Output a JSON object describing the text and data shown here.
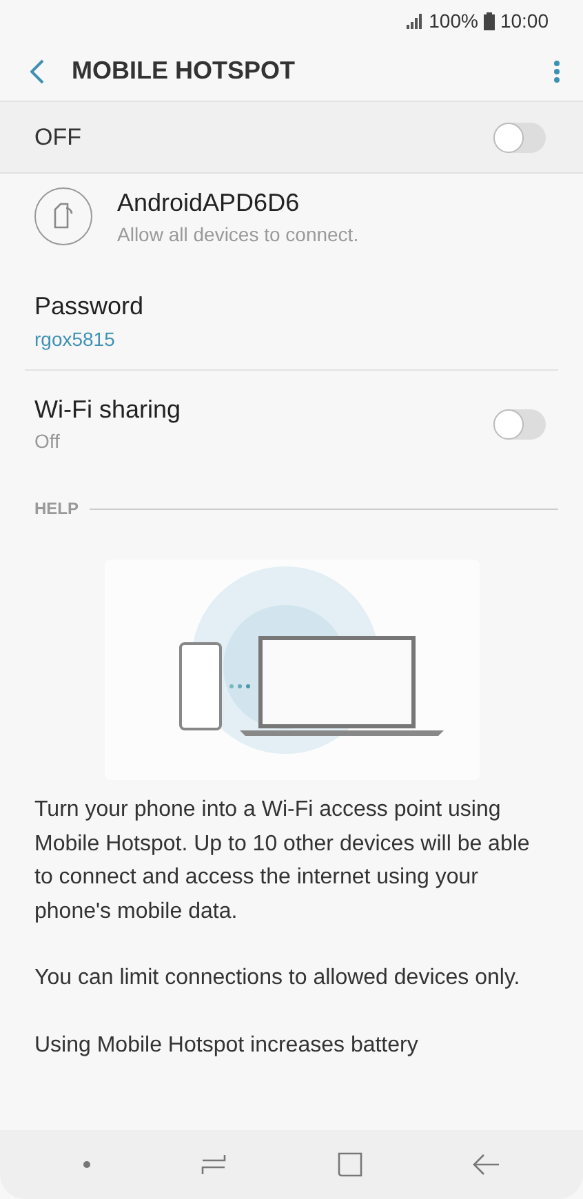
{
  "status_bar": {
    "battery": "100%",
    "time": "10:00"
  },
  "header": {
    "title": "MOBILE HOTSPOT"
  },
  "master_switch": {
    "label": "OFF",
    "on": false
  },
  "network": {
    "name": "AndroidAPD6D6",
    "subtitle": "Allow all devices to connect."
  },
  "password": {
    "label": "Password",
    "value": "rgox5815"
  },
  "wifi_sharing": {
    "label": "Wi-Fi sharing",
    "status": "Off",
    "on": false
  },
  "help": {
    "heading": "HELP",
    "paragraphs": [
      "Turn your phone into a Wi-Fi access point using Mobile Hotspot. Up to 10 other devices will be able to connect and access the internet using your phone's mobile data.",
      "You can limit connections to allowed devices only.",
      "Using Mobile Hotspot increases battery"
    ]
  }
}
